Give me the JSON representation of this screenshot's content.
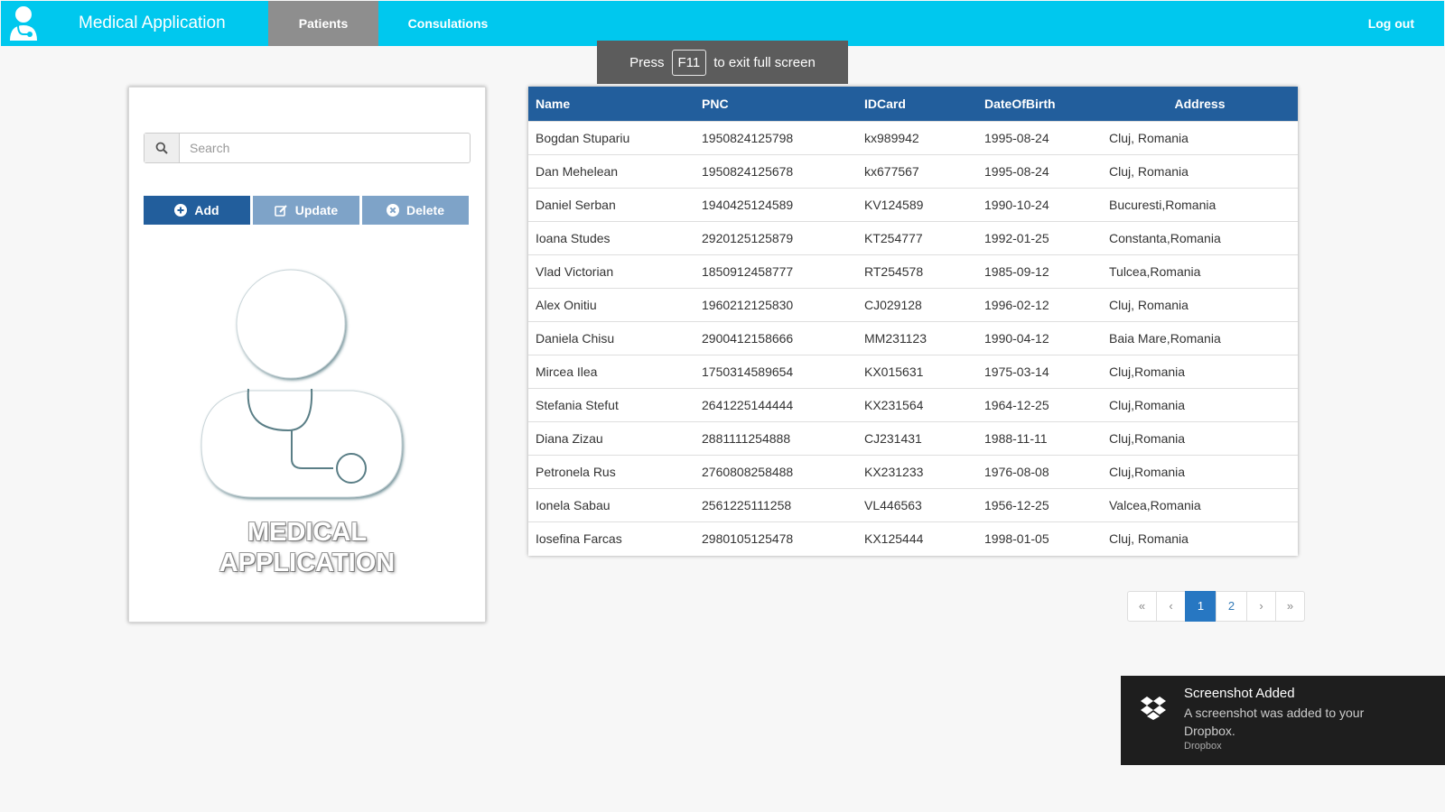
{
  "navbar": {
    "brand": "Medical Application",
    "tabs": [
      {
        "label": "Patients",
        "active": true
      },
      {
        "label": "Consulations",
        "active": false
      }
    ],
    "logout": "Log out",
    "color": "#00c8ee"
  },
  "fullscreen_hint": {
    "prefix": "Press",
    "key": "F11",
    "suffix": "to exit full screen"
  },
  "sidebar": {
    "search_placeholder": "Search",
    "search_icon": "search-icon",
    "buttons": {
      "add": "Add",
      "update": "Update",
      "delete": "Delete"
    },
    "illustration_text": {
      "line1": "MEDICAL",
      "line2": "APPLICATION"
    }
  },
  "table": {
    "headers": {
      "name": "Name",
      "pnc": "PNC",
      "idcard": "IDCard",
      "dob": "DateOfBirth",
      "address": "Address"
    },
    "header_color": "#225e9c",
    "rows": [
      [
        "Bogdan Stupariu",
        "1950824125798",
        "kx989942",
        "1995-08-24",
        "Cluj, Romania"
      ],
      [
        "Dan Mehelean",
        "1950824125678",
        "kx677567",
        "1995-08-24",
        "Cluj, Romania"
      ],
      [
        "Daniel Serban",
        "1940425124589",
        "KV124589",
        "1990-10-24",
        "Bucuresti,Romania"
      ],
      [
        "Ioana Studes",
        "2920125125879",
        "KT254777",
        "1992-01-25",
        "Constanta,Romania"
      ],
      [
        "Vlad Victorian",
        "1850912458777",
        "RT254578",
        "1985-09-12",
        "Tulcea,Romania"
      ],
      [
        "Alex Onitiu",
        "1960212125830",
        "CJ029128",
        "1996-02-12",
        "Cluj, Romania"
      ],
      [
        "Daniela Chisu",
        "2900412158666",
        "MM231123",
        "1990-04-12",
        "Baia Mare,Romania"
      ],
      [
        "Mircea Ilea",
        "1750314589654",
        "KX015631",
        "1975-03-14",
        "Cluj,Romania"
      ],
      [
        "Stefania Stefut",
        "2641225144444",
        "KX231564",
        "1964-12-25",
        "Cluj,Romania"
      ],
      [
        "Diana Zizau",
        "2881111254888",
        "CJ231431",
        "1988-11-11",
        "Cluj,Romania"
      ],
      [
        "Petronela Rus",
        "2760808258488",
        "KX231233",
        "1976-08-08",
        "Cluj,Romania"
      ],
      [
        "Ionela Sabau",
        "2561225111258",
        "VL446563",
        "1956-12-25",
        "Valcea,Romania"
      ],
      [
        "Iosefina Farcas",
        "2980105125478",
        "KX125444",
        "1998-01-05",
        "Cluj, Romania"
      ]
    ]
  },
  "pagination": {
    "first": "«",
    "prev": "‹",
    "pages": [
      "1",
      "2"
    ],
    "active_page": "1",
    "next": "›",
    "last": "»"
  },
  "notification": {
    "title": "Screenshot Added",
    "message": "A screenshot was added to your Dropbox.",
    "source": "Dropbox",
    "icon": "dropbox-icon"
  }
}
